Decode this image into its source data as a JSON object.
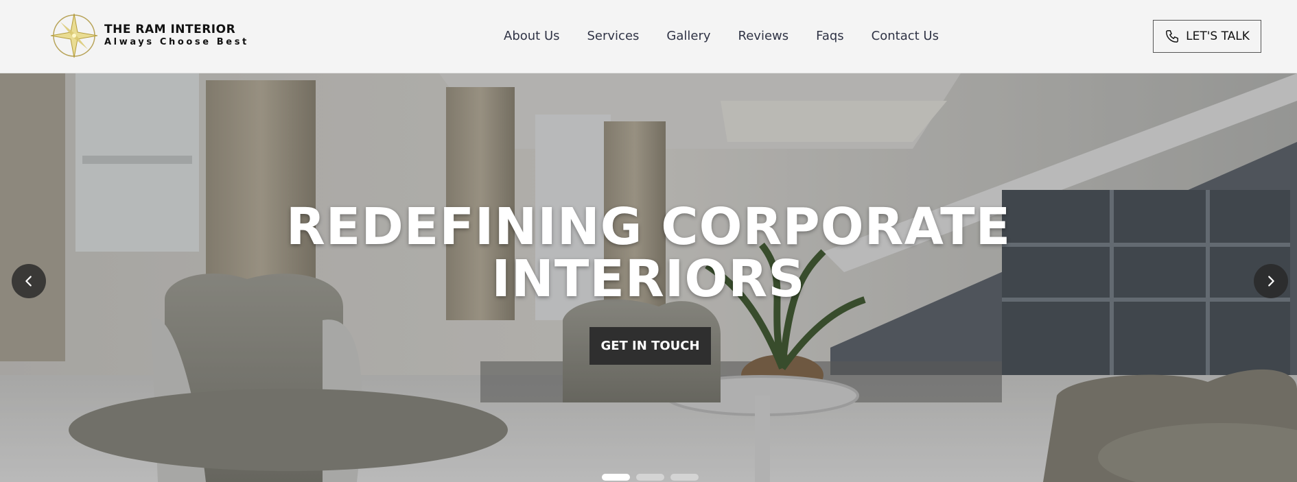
{
  "brand": {
    "name": "THE RAM INTERIOR",
    "tagline": "Always Choose Best",
    "emblem_icon": "compass-star-icon"
  },
  "nav": {
    "items": [
      {
        "label": "About Us"
      },
      {
        "label": "Services"
      },
      {
        "label": "Gallery"
      },
      {
        "label": "Reviews"
      },
      {
        "label": "Faqs"
      },
      {
        "label": "Contact Us"
      }
    ]
  },
  "cta": {
    "label": "LET'S TALK",
    "icon": "phone-icon"
  },
  "hero": {
    "title": "REDEFINING CORPORATE INTERIORS",
    "button_label": "GET IN TOUCH",
    "prev_icon": "chevron-left-icon",
    "next_icon": "chevron-right-icon",
    "slides_count": 3,
    "active_slide": 1
  },
  "colors": {
    "header_bg": "#f4f4f4",
    "nav_text": "#2f3345",
    "hero_button_bg": "#2f2f2f",
    "hero_text": "#ffffff"
  }
}
